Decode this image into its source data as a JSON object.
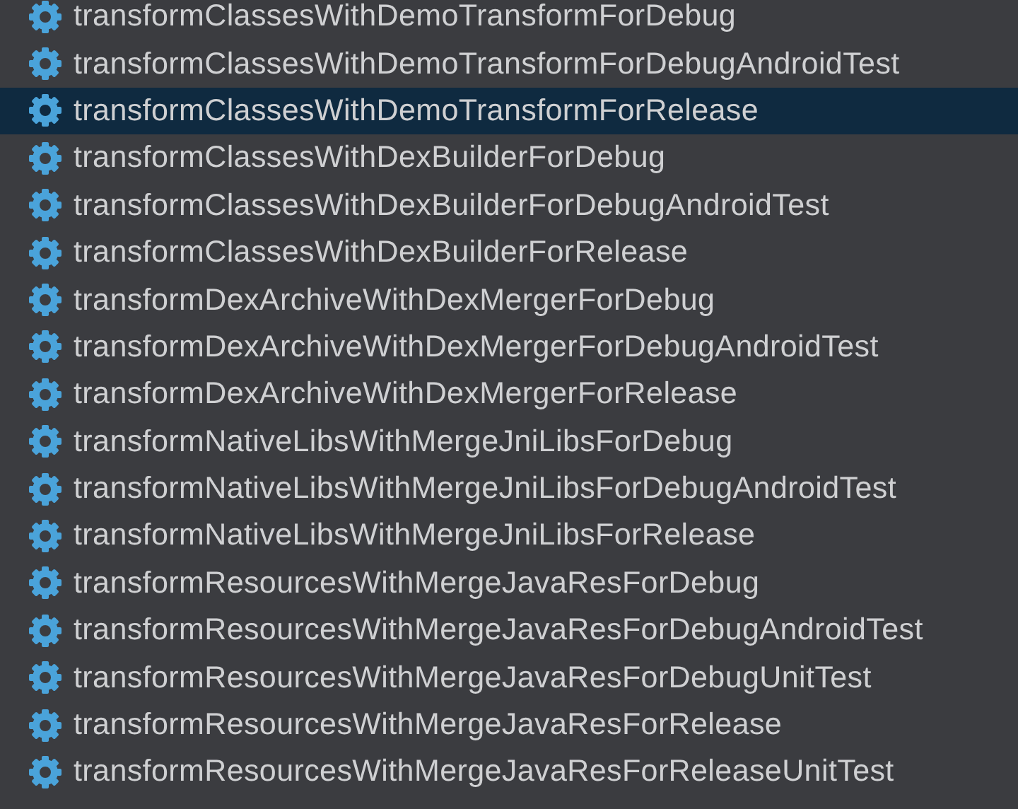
{
  "tasks": [
    {
      "label": "transformClassesWithDemoTransformForDebug",
      "selected": false
    },
    {
      "label": "transformClassesWithDemoTransformForDebugAndroidTest",
      "selected": false
    },
    {
      "label": "transformClassesWithDemoTransformForRelease",
      "selected": true
    },
    {
      "label": "transformClassesWithDexBuilderForDebug",
      "selected": false
    },
    {
      "label": "transformClassesWithDexBuilderForDebugAndroidTest",
      "selected": false
    },
    {
      "label": "transformClassesWithDexBuilderForRelease",
      "selected": false
    },
    {
      "label": "transformDexArchiveWithDexMergerForDebug",
      "selected": false
    },
    {
      "label": "transformDexArchiveWithDexMergerForDebugAndroidTest",
      "selected": false
    },
    {
      "label": "transformDexArchiveWithDexMergerForRelease",
      "selected": false
    },
    {
      "label": "transformNativeLibsWithMergeJniLibsForDebug",
      "selected": false
    },
    {
      "label": "transformNativeLibsWithMergeJniLibsForDebugAndroidTest",
      "selected": false
    },
    {
      "label": "transformNativeLibsWithMergeJniLibsForRelease",
      "selected": false
    },
    {
      "label": "transformResourcesWithMergeJavaResForDebug",
      "selected": false
    },
    {
      "label": "transformResourcesWithMergeJavaResForDebugAndroidTest",
      "selected": false
    },
    {
      "label": "transformResourcesWithMergeJavaResForDebugUnitTest",
      "selected": false
    },
    {
      "label": "transformResourcesWithMergeJavaResForRelease",
      "selected": false
    },
    {
      "label": "transformResourcesWithMergeJavaResForReleaseUnitTest",
      "selected": false
    }
  ]
}
